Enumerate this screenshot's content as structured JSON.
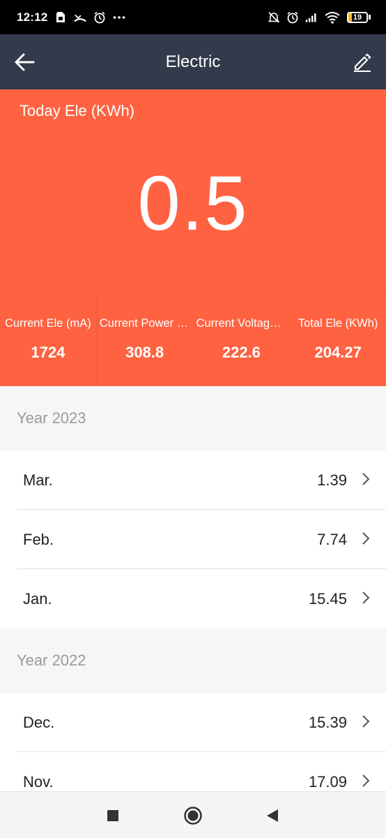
{
  "status_bar": {
    "time": "12:12",
    "left_icons": [
      "sim-icon",
      "call-missed-icon",
      "alarm-icon",
      "more-icon"
    ],
    "right_icons": [
      "mute-icon",
      "alarm-icon",
      "signal-icon",
      "wifi-icon"
    ],
    "battery_level": "19"
  },
  "app_bar": {
    "title": "Electric"
  },
  "hero": {
    "label": "Today Ele (KWh)",
    "value": "0.5",
    "stats": [
      {
        "label": "Current Ele (mA)",
        "value": "1724"
      },
      {
        "label": "Current Power (…",
        "value": "308.8"
      },
      {
        "label": "Current Voltage…",
        "value": "222.6"
      },
      {
        "label": "Total Ele (KWh)",
        "value": "204.27"
      }
    ]
  },
  "years": [
    {
      "label": "Year 2023",
      "months": [
        {
          "month": "Mar.",
          "value": "1.39"
        },
        {
          "month": "Feb.",
          "value": "7.74"
        },
        {
          "month": "Jan.",
          "value": "15.45"
        }
      ]
    },
    {
      "label": "Year 2022",
      "months": [
        {
          "month": "Dec.",
          "value": "15.39"
        },
        {
          "month": "Nov.",
          "value": "17.09"
        }
      ]
    }
  ],
  "colors": {
    "accent": "#fe6241",
    "app_bar": "#323a4b",
    "section_bg": "#f6f6f6"
  }
}
